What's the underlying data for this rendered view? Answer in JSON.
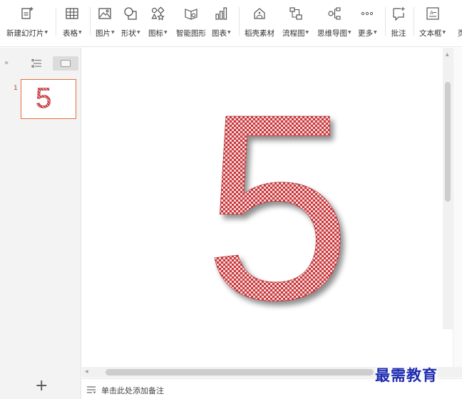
{
  "ribbon": {
    "tools": [
      {
        "label": "新建幻灯片",
        "icon": "new-slide-icon",
        "dropdown": true
      },
      {
        "label": "表格",
        "icon": "table-icon",
        "dropdown": true
      },
      {
        "label": "图片",
        "icon": "picture-icon",
        "dropdown": true
      },
      {
        "label": "形状",
        "icon": "shape-icon",
        "dropdown": true
      },
      {
        "label": "图标",
        "icon": "icons-icon",
        "dropdown": true
      },
      {
        "label": "智能图形",
        "icon": "smart-graphic-icon",
        "dropdown": false
      },
      {
        "label": "图表",
        "icon": "chart-icon",
        "dropdown": true
      },
      {
        "label": "稻壳素材",
        "icon": "docer-material-icon",
        "dropdown": false
      },
      {
        "label": "流程图",
        "icon": "flowchart-icon",
        "dropdown": true
      },
      {
        "label": "思维导图",
        "icon": "mind-map-icon",
        "dropdown": true
      },
      {
        "label": "更多",
        "icon": "more-icon",
        "dropdown": true
      },
      {
        "label": "批注",
        "icon": "comment-icon",
        "dropdown": false
      },
      {
        "label": "文本框",
        "icon": "textbox-icon",
        "dropdown": true
      },
      {
        "label": "页",
        "icon": "page-icon",
        "dropdown": false
      }
    ]
  },
  "left_panel": {
    "expand_glyph": "»",
    "slide_number": "1",
    "add_glyph": "+"
  },
  "slide": {
    "text": "5",
    "thumb_text": "5",
    "fill_colors": [
      "#c8373c",
      "#f6d5d5"
    ]
  },
  "notes": {
    "placeholder": "单击此处添加备注"
  },
  "watermark": {
    "text": "最需教育"
  },
  "colors": {
    "accent": "#e2703b",
    "watermark": "#1f2bb0"
  }
}
